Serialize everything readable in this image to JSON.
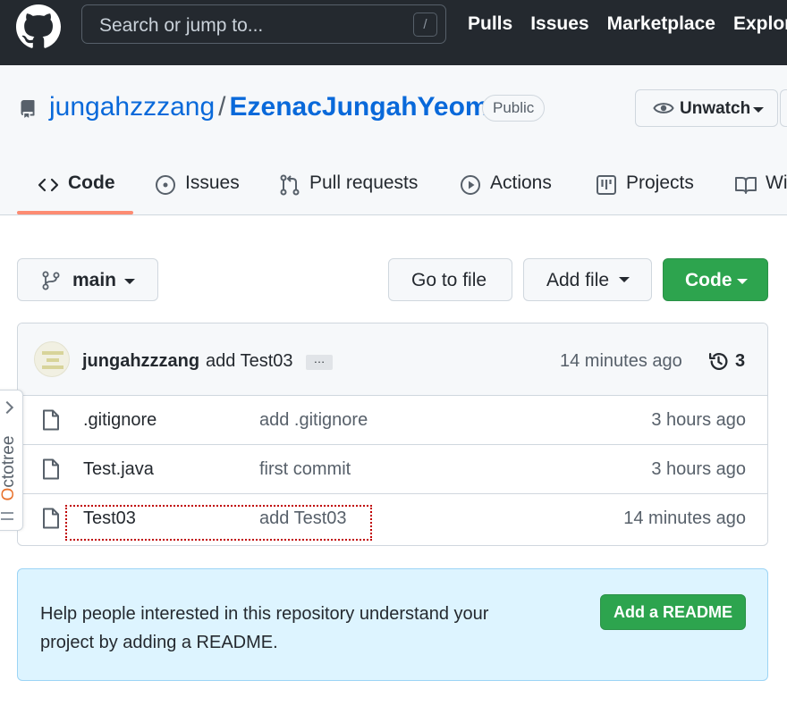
{
  "header": {
    "search_placeholder": "Search or jump to...",
    "search_shortcut": "/",
    "nav": [
      "Pulls",
      "Issues",
      "Marketplace",
      "Explore"
    ]
  },
  "repo": {
    "owner": "jungahzzzang",
    "separator": "/",
    "name": "EzenacJungahYeom",
    "visibility": "Public",
    "watch_label": "Unwatch"
  },
  "tabs": [
    {
      "label": "Code",
      "icon": "code-icon",
      "selected": true
    },
    {
      "label": "Issues",
      "icon": "issue-icon"
    },
    {
      "label": "Pull requests",
      "icon": "pull-request-icon"
    },
    {
      "label": "Actions",
      "icon": "play-icon"
    },
    {
      "label": "Projects",
      "icon": "project-icon"
    },
    {
      "label": "Wiki",
      "icon": "book-icon"
    }
  ],
  "toolbar": {
    "branch": "main",
    "go_to_file": "Go to file",
    "add_file": "Add file",
    "code": "Code"
  },
  "latest_commit": {
    "author": "jungahzzzang",
    "message": "add Test03",
    "ellipsis": "…",
    "time": "14 minutes ago",
    "count": "3"
  },
  "files": [
    {
      "name": ".gitignore",
      "message": "add .gitignore",
      "time": "3 hours ago"
    },
    {
      "name": "Test.java",
      "message": "first commit",
      "time": "3 hours ago"
    },
    {
      "name": "Test03",
      "message": "add Test03",
      "time": "14 minutes ago"
    }
  ],
  "octotree": {
    "label_first": "O",
    "label_rest": "ctotree"
  },
  "readme": {
    "text": "Help people interested in this repository understand your project by adding a README.",
    "button": "Add a README"
  },
  "colors": {
    "header_bg": "#24292f",
    "link": "#0969da",
    "green": "#2da44e",
    "tab_underline": "#fd8c73",
    "readme_bg": "#ddf4ff",
    "highlight": "#c00000"
  }
}
